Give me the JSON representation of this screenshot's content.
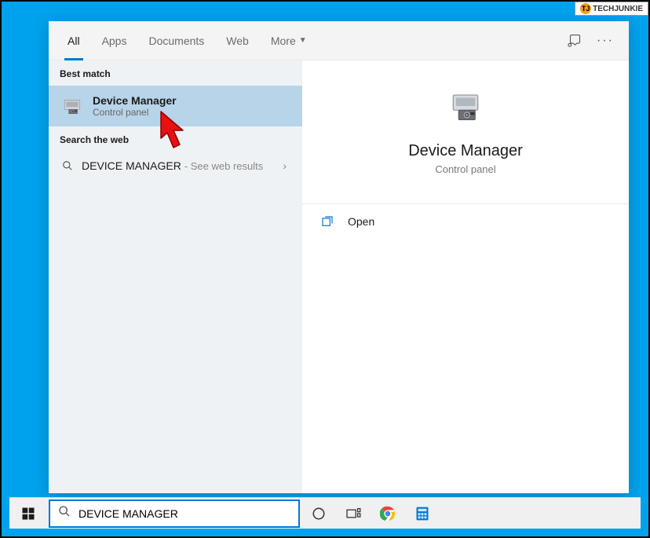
{
  "watermark": {
    "logo": "TJ",
    "text": "TECHJUNKIE"
  },
  "tabs": {
    "all": "All",
    "apps": "Apps",
    "documents": "Documents",
    "web": "Web",
    "more": "More"
  },
  "left": {
    "best_match_header": "Best match",
    "best_match": {
      "title": "Device Manager",
      "subtitle": "Control panel"
    },
    "web_header": "Search the web",
    "web_item": {
      "query": "DEVICE MANAGER",
      "suffix": "- See web results"
    }
  },
  "preview": {
    "title": "Device Manager",
    "subtitle": "Control panel",
    "actions": {
      "open": "Open"
    }
  },
  "search": {
    "value": "DEVICE MANAGER"
  }
}
